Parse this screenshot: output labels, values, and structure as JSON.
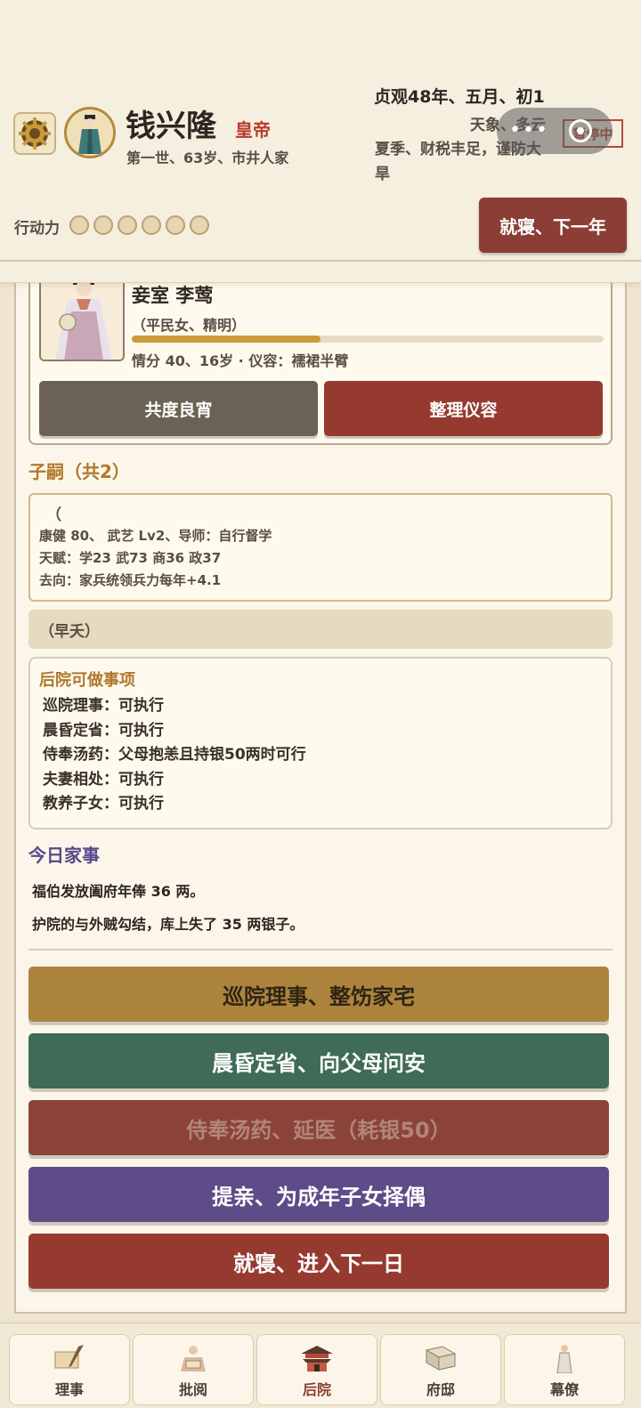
{
  "header": {
    "ruler_name": "钱兴隆",
    "ruler_title": "皇帝",
    "ruler_sub": "第一世、63岁、市井人家",
    "date": "贞观48年、五月、初1",
    "weather": "天象、多云",
    "season": "夏季、财税丰足，谨防大旱",
    "pause_tag": "暂停中",
    "action_points_label": "行动力",
    "action_points_total": 6,
    "action_points_filled": 0,
    "sleep_year_label": "就寝、下一年"
  },
  "consort": {
    "name": "妾室 李莺",
    "desc": "（平民女、精明）",
    "favor_percent": 40,
    "stats": "情分 40、16岁 · 仪容：襦裙半臂",
    "btn_spend": "共度良宵",
    "btn_groom": "整理仪容"
  },
  "heirs": {
    "title": "子嗣（共2）",
    "first": {
      "name": "（",
      "line1": "康健 80、 武艺 Lv2、导师：自行督学",
      "line2": "天赋：学23 武73 商36 政37",
      "line3": "去向：家兵统领兵力每年+4.1"
    },
    "second": "（早夭）"
  },
  "tasks": {
    "title": "后院可做事项",
    "items": [
      "巡院理事：可执行",
      "晨昏定省：可执行",
      "侍奉汤药：父母抱恙且持银50两时可行",
      "夫妻相处：可执行",
      "教养子女：可执行"
    ]
  },
  "today": {
    "title": "今日家事",
    "events": [
      "福伯发放阖府年俸 36 两。",
      "护院的与外贼勾结，库上失了 35 两银子。"
    ]
  },
  "actions": {
    "a1": "巡院理事、整饬家宅",
    "a2": "晨昏定省、向父母问安",
    "a3": "侍奉汤药、延医（耗银50）",
    "a4": "提亲、为成年子女择偶",
    "a5": "就寝、进入下一日"
  },
  "nav": {
    "items": [
      "理事",
      "批阅",
      "后院",
      "府邸",
      "幕僚"
    ],
    "active": "后院"
  },
  "colors": {
    "accent_red": "#963a30",
    "gold": "#b0782e",
    "purple": "#5d4c88",
    "green": "#406b57"
  }
}
